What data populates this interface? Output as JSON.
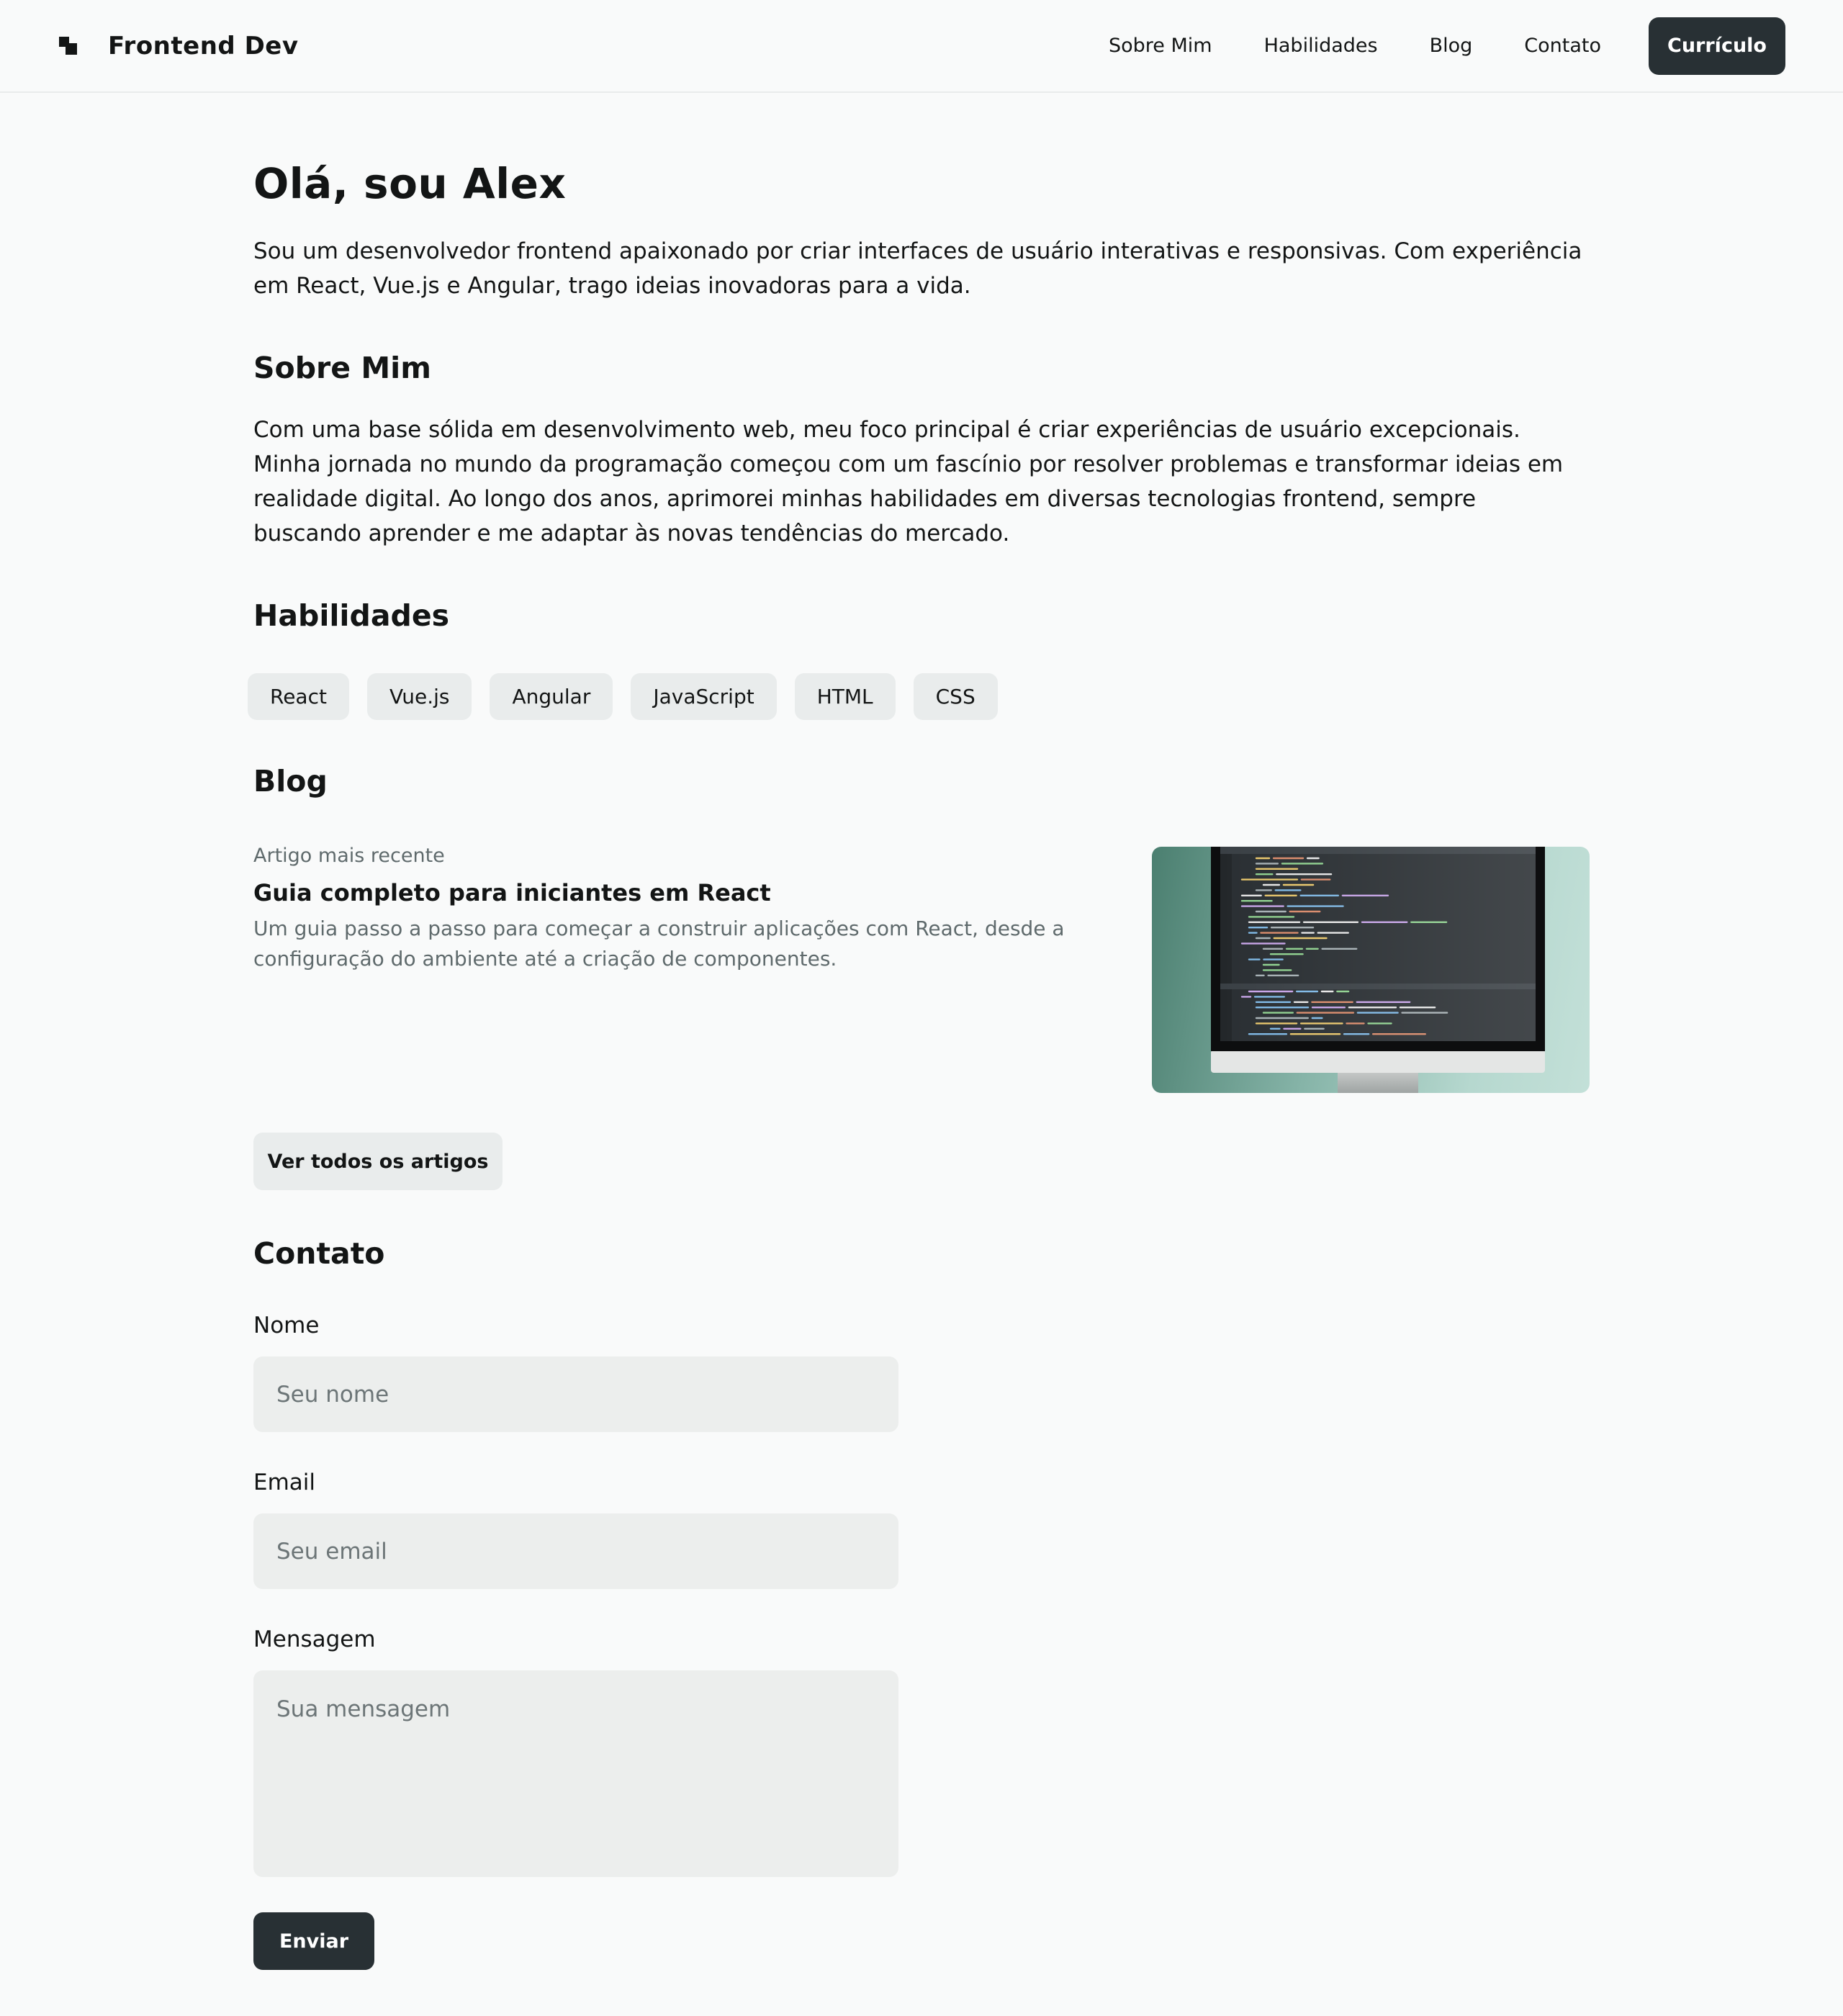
{
  "header": {
    "brand_icon": "blocks-logo-icon",
    "brand_name": "Frontend Dev",
    "nav": [
      "Sobre Mim",
      "Habilidades",
      "Blog",
      "Contato"
    ],
    "cta_label": "Currículo"
  },
  "hero": {
    "title": "Olá, sou Alex",
    "text": "Sou um desenvolvedor frontend apaixonado por criar interfaces de usuário interativas e responsivas. Com experiência em React, Vue.js e Angular, trago ideias inovadoras para a vida."
  },
  "about": {
    "title": "Sobre Mim",
    "text": "Com uma base sólida em desenvolvimento web, meu foco principal é criar experiências de usuário excepcionais. Minha jornada no mundo da programação começou com um fascínio por resolver problemas e transformar ideias em realidade digital. Ao longo dos anos, aprimorei minhas habilidades em diversas tecnologias frontend, sempre buscando aprender e me adaptar às novas tendências do mercado."
  },
  "skills": {
    "title": "Habilidades",
    "items": [
      "React",
      "Vue.js",
      "Angular",
      "JavaScript",
      "HTML",
      "CSS"
    ]
  },
  "blog": {
    "title": "Blog",
    "kicker": "Artigo mais recente",
    "post_title": "Guia completo para iniciantes em React",
    "post_desc": "Um guia passo a passo para começar a construir aplicações com React, desde a configuração do ambiente até a criação de componentes.",
    "image": "monitor-with-code-editor",
    "all_label": "Ver todos os artigos"
  },
  "contact": {
    "title": "Contato",
    "name_label": "Nome",
    "name_placeholder": "Seu nome",
    "email_label": "Email",
    "email_placeholder": "Seu email",
    "message_label": "Mensagem",
    "message_placeholder": "Sua mensagem",
    "send_label": "Enviar"
  },
  "colors": {
    "background": "#f9fafa",
    "text": "#131515",
    "muted_text": "#5f6a6c",
    "dark_button": "#283034",
    "light_surface": "#e9ecec",
    "input_surface": "#eceeed"
  }
}
